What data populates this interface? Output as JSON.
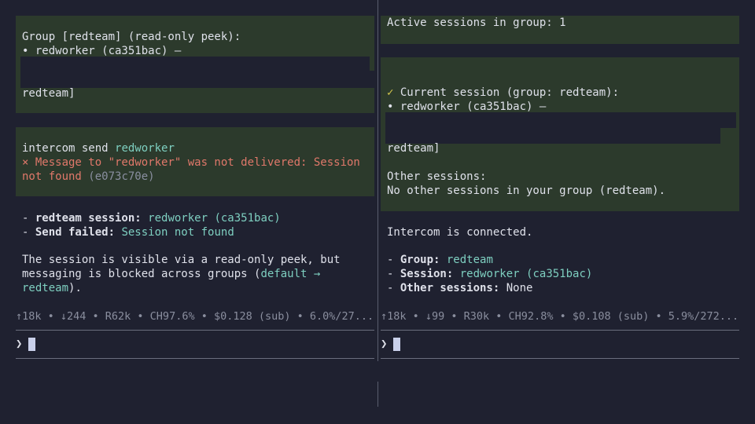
{
  "left": {
    "peek": {
      "line1": "Group [redteam] (read-only peek):",
      "line2": "• redworker (ca351bac) —",
      "line3": "redteam]"
    },
    "send": {
      "cmd": "intercom send ",
      "target": "redworker",
      "error_prefix": "× Message to \"redworker\" was not delivered: Session",
      "error_tail": "not found",
      "error_hash": "(e073c70e)"
    },
    "summary": {
      "dash": "- ",
      "session_key": "redteam session:",
      "session_name": "redworker",
      "session_id": "(ca351bac)",
      "failed_key": "Send failed:",
      "failed_value": "Session not found",
      "para1": "The session is visible via a read-only peek, but",
      "para2_a": "messaging is blocked across groups (",
      "para2_b": "default →",
      "para3_a": "redteam",
      "para3_b": ")."
    },
    "status": "↑18k • ↓244 • R62k • CH97.6% • $0.128 (sub) • 6.0%/27...",
    "prompt_glyph": "❯"
  },
  "right": {
    "active": "Active sessions in group: 1",
    "current": {
      "check": "✓",
      "line1": " Current session (group: redteam):",
      "line2": "• redworker (ca351bac) —",
      "line3": "redteam]",
      "other_head": "Other sessions:",
      "other_none": "No other sessions in your group (redteam)."
    },
    "connected": "Intercom is connected.",
    "summary": {
      "dash": "- ",
      "group_key": "Group:",
      "group_val": "redteam",
      "session_key": "Session:",
      "session_name": "redworker",
      "session_id": "(ca351bac)",
      "other_key": "Other sessions:",
      "other_val": "None"
    },
    "status": "↑18k • ↓99 • R30k • CH92.8% • $0.108 (sub) • 5.9%/272...",
    "prompt_glyph": "❯"
  }
}
